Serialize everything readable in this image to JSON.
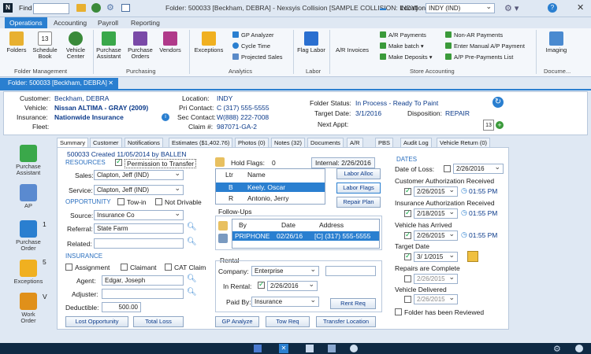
{
  "titlebar": {
    "app_icon": "nexsyis-logo-icon",
    "find_label": "Find",
    "find_value": "",
    "folder_title": "Folder: 500033 [Beckham, DEBRA] - Nexsyis Collision [SAMPLE COLLISION: INDY]",
    "location_label": "Location",
    "location_value": "INDY (IND)"
  },
  "ribbon_tabs": [
    "Operations",
    "Accounting",
    "Payroll",
    "Reporting"
  ],
  "ribbon": {
    "folders": "Folders",
    "schedule": "Schedule\nBook",
    "schedule_num": "13",
    "vehicle": "Vehicle\nCenter",
    "purchase_assistant": "Purchase\nAssistant",
    "purchase_orders": "Purchase\nOrders",
    "vendors": "Vendors",
    "exceptions": "Exceptions",
    "gp_analyzer": "GP Analyzer",
    "cycle_time": "Cycle Time",
    "projected_sales": "Projected Sales",
    "flag_labor": "Flag Labor",
    "ar_invoices": "A/R Invoices",
    "ar_payments": "A/R Payments",
    "make_batch": "Make batch",
    "make_deposits": "Make Deposits",
    "nonar_payments": "Non-AR Payments",
    "enter_manual": "Enter Manual A/P Payment",
    "ap_pre_payments": "A/P Pre-Payments List",
    "imaging": "Imaging",
    "groups": [
      "Folder Management",
      "Purchasing",
      "Analytics",
      "Labor",
      "Store Accounting",
      "Docume..."
    ]
  },
  "doc_tab": "Folder: 500033 [Beckham, DEBRA]",
  "header": {
    "customer_label": "Customer:",
    "customer": "Beckham, DEBRA",
    "vehicle_label": "Vehicle:",
    "vehicle": "Nissan ALTIMA - GRAY (2009)",
    "insurance_label": "Insurance:",
    "insurance": "Nationwide Insurance",
    "fleet_label": "Fleet:",
    "fleet": "",
    "location_label": "Location:",
    "location": "INDY",
    "pri_contact_label": "Pri Contact:",
    "pri_contact": "C (317) 555-5555",
    "sec_contact_label": "Sec Contact:",
    "sec_contact": "W(888) 222-7008",
    "claim_label": "Claim #:",
    "claim": "987071-GA-2",
    "folder_status_label": "Folder Status:",
    "folder_status": "In Process - Ready To Paint",
    "target_date_label": "Target Date:",
    "target_date": "3/1/2016",
    "disposition_label": "Disposition:",
    "disposition": "REPAIR",
    "next_appt_label": "Next Appt:",
    "next_appt": "",
    "cal_num": "13"
  },
  "sidebar": [
    {
      "label": "Purchase\nAssistant",
      "badge": ""
    },
    {
      "label": "AP",
      "badge": ""
    },
    {
      "label": "Purchase\nOrder",
      "badge": "1"
    },
    {
      "label": "Exceptions",
      "badge": "5"
    },
    {
      "label": "Work\nOrder",
      "badge": "V"
    }
  ],
  "tabs": [
    "Summary",
    "Customer",
    "Notifications",
    "Estimates ($1,402.76)",
    "Photos (0)",
    "Notes (32)",
    "Documents",
    "A/R",
    "PBS",
    "Audit Log",
    "Vehicle Return (0)"
  ],
  "summary": {
    "folder_line": "500033 Created 11/05/2014 by BALLEN",
    "resources_label": "RESOURCES",
    "permission_label": "Permission to Transfer",
    "sales_label": "Sales:",
    "sales": "Clapton, Jeff (IND)",
    "service_label": "Service:",
    "service": "Clapton, Jeff (IND)",
    "opportunity_label": "OPPORTUNITY",
    "tow_in_label": "Tow-in",
    "not_driveable_label": "Not Drivable",
    "source_label": "Source:",
    "source": "Insurance Co",
    "referral_label": "Referral:",
    "referral": "State Farm",
    "related_label": "Related:",
    "related": "",
    "insurance_label": "INSURANCE",
    "assignment_label": "Assignment",
    "claimant_label": "Claimant",
    "cat_claim_label": "CAT Claim",
    "agent_label": "Agent:",
    "agent": "Edgar, Joseph",
    "adjuster_label": "Adjuster:",
    "adjuster": "",
    "deductible_label": "Deductible:",
    "deductible": "500.00",
    "lost_opportunity": "Lost Opportunity",
    "total_loss": "Total Loss",
    "hold_flags_label": "Hold Flags:",
    "hold_flags": "0",
    "internal": "Internal: 2/26/2016",
    "labor_col_ltr": "Ltr",
    "labor_col_name": "Name",
    "labor_rows": [
      {
        "ltr": "B",
        "name": "Keely, Oscar"
      },
      {
        "ltr": "R",
        "name": "Antonio, Jerry"
      }
    ],
    "labor_alloc": "Labor Alloc",
    "labor_flags": "Labor Flags",
    "repair_plan": "Repair Plan",
    "followups_label": "Follow-Ups",
    "fu_by": "By",
    "fu_date": "Date",
    "fu_address": "Address",
    "fu_rows": [
      {
        "by": "PRIPHONE",
        "date": "02/26/16",
        "address": "[C] (317) 555-5555"
      }
    ],
    "rental_label": "Rental",
    "company_label": "Company:",
    "company": "Enterprise",
    "in_rental_label": "In Rental:",
    "in_rental": "2/26/2016",
    "paid_by_label": "Paid By:",
    "paid_by": "Insurance",
    "rent_req": "Rent Req",
    "gp_analyze": "GP Analyze",
    "tow_req": "Tow Req",
    "transfer_location": "Transfer Location"
  },
  "dates": {
    "title": "DATES",
    "date_of_loss_label": "Date of Loss:",
    "date_of_loss": "2/26/2016",
    "cust_auth_label": "Customer Authorization Received",
    "cust_auth": "2/26/2015",
    "cust_auth_time": "01:55 PM",
    "ins_auth_label": "Insurance Authorization Received",
    "ins_auth": "2/18/2015",
    "ins_auth_time": "01:55 PM",
    "arrived_label": "Vehicle has Arrived",
    "arrived": "2/26/2015",
    "arrived_time": "01:55 PM",
    "target_label": "Target Date",
    "target": "3/ 1/2015",
    "repairs_label": "Repairs are Complete",
    "repairs": "2/26/2015",
    "delivered_label": "Vehicle Delivered",
    "delivered": "2/26/2015",
    "folder_reviewed_label": "Folder has been Reviewed"
  },
  "colors": {
    "accent": "#2a7fd0",
    "link": "#0b3a8a",
    "selected_row": "#2a7fd0"
  }
}
